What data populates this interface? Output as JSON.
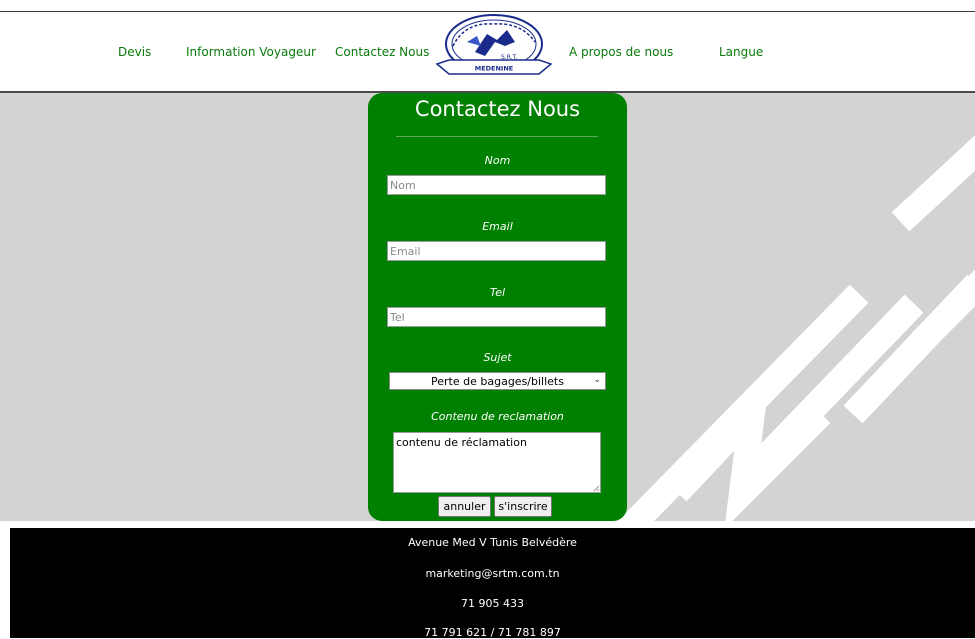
{
  "nav": {
    "items": [
      "Devis",
      "Information Voyageur",
      "Contactez Nous",
      "A propos de nous",
      "Langue"
    ]
  },
  "logo": {
    "text": "S.R.T.",
    "city": "MEDENINE"
  },
  "form": {
    "title": "Contactez Nous",
    "nom_label": "Nom",
    "nom_placeholder": "Nom",
    "email_label": "Email",
    "email_placeholder": "Email",
    "tel_label": "Tel",
    "tel_placeholder": "Tel",
    "sujet_label": "Sujet",
    "sujet_selected": "Perte de bagages/billets",
    "contenu_label": "Contenu de reclamation",
    "contenu_value": "contenu de réclamation",
    "cancel_label": "annuler",
    "submit_label": "s'inscrire"
  },
  "footer": {
    "address": "Avenue Med V Tunis Belvédère",
    "email": "marketing@srtm.com.tn",
    "phone": "71 905 433",
    "phones2": "71 791 621 / 71 781 897"
  },
  "colors": {
    "green": "#008000",
    "link": "#0a7a0a",
    "gray_bg": "#d3d3d3",
    "footer_bg": "#000000"
  }
}
